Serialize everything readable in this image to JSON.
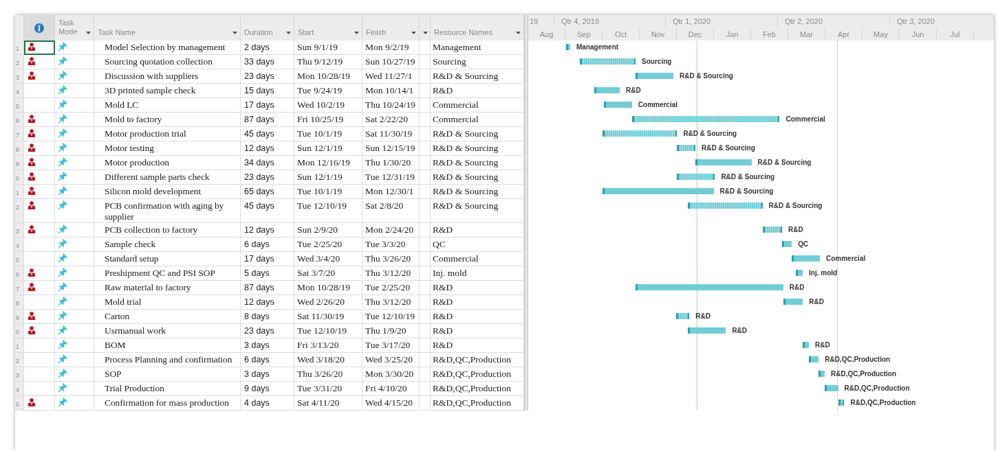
{
  "columns": {
    "task_mode": "Task Mode",
    "task_name": "Task Name",
    "duration": "Duration",
    "start": "Start",
    "finish": "Finish",
    "resource_names": "Resource Names"
  },
  "timescale": {
    "quarters": [
      "19",
      "Qtr 4, 2019",
      "Qtr 1, 2020",
      "Qtr 2, 2020",
      "Qtr 3, 2020"
    ],
    "months": [
      "Aug",
      "Sep",
      "Oct",
      "Nov",
      "Dec",
      "Jan",
      "Feb",
      "Mar",
      "Apr",
      "May",
      "Jun",
      "Jul"
    ]
  },
  "tasks": [
    {
      "id": "1",
      "resource_indicator": true,
      "selected": true,
      "name": "Model Selection by management",
      "duration": "2 days",
      "start": "Sun 9/1/19",
      "finish": "Mon 9/2/19",
      "resources": "Management",
      "bar_label": "Management",
      "hatched": false
    },
    {
      "id": "2",
      "resource_indicator": true,
      "selected": false,
      "name": "Sourcing quotation collection",
      "duration": "33 days",
      "start": "Thu 9/12/19",
      "finish": "Sun 10/27/19",
      "resources": "Sourcing",
      "bar_label": "Sourcing",
      "hatched": true
    },
    {
      "id": "3",
      "resource_indicator": true,
      "selected": false,
      "name": "Discussion with suppliers",
      "duration": "23 days",
      "start": "Mon 10/28/19",
      "finish": "Wed 11/27/1",
      "resources": "R&D & Sourcing",
      "bar_label": "R&D & Sourcing",
      "hatched": false
    },
    {
      "id": "4",
      "resource_indicator": false,
      "selected": false,
      "name": "3D printed sample check",
      "duration": "15 days",
      "start": "Tue 9/24/19",
      "finish": "Mon 10/14/1",
      "resources": "R&D",
      "bar_label": "R&D",
      "hatched": false
    },
    {
      "id": "5",
      "resource_indicator": false,
      "selected": false,
      "name": "Mold LC",
      "duration": "17 days",
      "start": "Wed 10/2/19",
      "finish": "Thu 10/24/19",
      "resources": "Commercial",
      "bar_label": "Commercial",
      "hatched": false
    },
    {
      "id": "6",
      "resource_indicator": true,
      "selected": false,
      "name": "Mold to factory",
      "duration": "87 days",
      "start": "Fri 10/25/19",
      "finish": "Sat 2/22/20",
      "resources": "Commercial",
      "bar_label": "Commercial",
      "hatched": true
    },
    {
      "id": "7",
      "resource_indicator": true,
      "selected": false,
      "name": "Motor production trial",
      "duration": "45 days",
      "start": "Tue 10/1/19",
      "finish": "Sat 11/30/19",
      "resources": "R&D & Sourcing",
      "bar_label": "R&D & Sourcing",
      "hatched": true
    },
    {
      "id": "8",
      "resource_indicator": true,
      "selected": false,
      "name": "Motor testing",
      "duration": "12 days",
      "start": "Sun 12/1/19",
      "finish": "Sun 12/15/19",
      "resources": "R&D & Sourcing",
      "bar_label": "R&D & Sourcing",
      "hatched": true
    },
    {
      "id": "9",
      "resource_indicator": true,
      "selected": false,
      "name": "Motor production",
      "duration": "34 days",
      "start": "Mon 12/16/19",
      "finish": "Thu 1/30/20",
      "resources": "R&D & Sourcing",
      "bar_label": "R&D & Sourcing",
      "hatched": false
    },
    {
      "id": "0",
      "resource_indicator": true,
      "selected": false,
      "name": "Different sample parts check",
      "duration": "23 days",
      "start": "Sun 12/1/19",
      "finish": "Tue 12/31/19",
      "resources": "R&D & Sourcing",
      "bar_label": "R&D & Sourcing",
      "hatched": true
    },
    {
      "id": "1",
      "resource_indicator": true,
      "selected": false,
      "name": "Silicon mold development",
      "duration": "65 days",
      "start": "Tue 10/1/19",
      "finish": "Mon 12/30/1",
      "resources": "R&D & Sourcing",
      "bar_label": "R&D & Sourcing",
      "hatched": false
    },
    {
      "id": "2",
      "resource_indicator": true,
      "selected": false,
      "name": "PCB confirmation with aging by supplier",
      "duration": "45 days",
      "start": "Tue 12/10/19",
      "finish": "Sat 2/8/20",
      "resources": "R&D & Sourcing",
      "bar_label": "R&D & Sourcing",
      "hatched": true
    },
    {
      "id": "3",
      "resource_indicator": true,
      "selected": false,
      "name": "PCB collection to factory",
      "duration": "12 days",
      "start": "Sun 2/9/20",
      "finish": "Mon 2/24/20",
      "resources": "R&D",
      "bar_label": "R&D",
      "hatched": true
    },
    {
      "id": "4",
      "resource_indicator": false,
      "selected": false,
      "name": "Sample check",
      "duration": "6 days",
      "start": "Tue 2/25/20",
      "finish": "Tue 3/3/20",
      "resources": "QC",
      "bar_label": "QC",
      "hatched": false
    },
    {
      "id": "5",
      "resource_indicator": false,
      "selected": false,
      "name": "Standard setup",
      "duration": "17 days",
      "start": "Wed 3/4/20",
      "finish": "Thu 3/26/20",
      "resources": "Commercial",
      "bar_label": "Commercial",
      "hatched": false
    },
    {
      "id": "6",
      "resource_indicator": true,
      "selected": false,
      "name": "Preshipment QC and PSI SOP",
      "duration": "5 days",
      "start": "Sat 3/7/20",
      "finish": "Thu 3/12/20",
      "resources": "Inj. mold",
      "bar_label": "Inj. mold",
      "hatched": false
    },
    {
      "id": "7",
      "resource_indicator": true,
      "selected": false,
      "name": "Raw material to factory",
      "duration": "87 days",
      "start": "Mon 10/28/19",
      "finish": "Tue 2/25/20",
      "resources": "R&D",
      "bar_label": "R&D",
      "hatched": false
    },
    {
      "id": "8",
      "resource_indicator": false,
      "selected": false,
      "name": "Mold trial",
      "duration": "12 days",
      "start": "Wed 2/26/20",
      "finish": "Thu 3/12/20",
      "resources": "R&D",
      "bar_label": "R&D",
      "hatched": false
    },
    {
      "id": "9",
      "resource_indicator": true,
      "selected": false,
      "name": "Carton",
      "duration": "8 days",
      "start": "Sat 11/30/19",
      "finish": "Tue 12/10/19",
      "resources": "R&D",
      "bar_label": "R&D",
      "hatched": true
    },
    {
      "id": "0",
      "resource_indicator": true,
      "selected": false,
      "name": "Usrmanual work",
      "duration": "23 days",
      "start": "Tue 12/10/19",
      "finish": "Thu 1/9/20",
      "resources": "R&D",
      "bar_label": "R&D",
      "hatched": false
    },
    {
      "id": "1",
      "resource_indicator": false,
      "selected": false,
      "name": "BOM",
      "duration": "3 days",
      "start": "Fri 3/13/20",
      "finish": "Tue 3/17/20",
      "resources": "R&D",
      "bar_label": "R&D",
      "hatched": false
    },
    {
      "id": "2",
      "resource_indicator": false,
      "selected": false,
      "name": "Process Planning and confirmation",
      "duration": "6 days",
      "start": "Wed 3/18/20",
      "finish": "Wed 3/25/20",
      "resources": "R&D,QC,Production",
      "bar_label": "R&D,QC,Production",
      "hatched": false
    },
    {
      "id": "3",
      "resource_indicator": false,
      "selected": false,
      "name": "SOP",
      "duration": "3 days",
      "start": "Thu 3/26/20",
      "finish": "Mon 3/30/20",
      "resources": "R&D,QC,Production",
      "bar_label": "R&D,QC,Production",
      "hatched": false
    },
    {
      "id": "4",
      "resource_indicator": false,
      "selected": false,
      "name": "Trial Production",
      "duration": "9 days",
      "start": "Tue 3/31/20",
      "finish": "Fri 4/10/20",
      "resources": "R&D,QC,Production",
      "bar_label": "R&D,QC,Production",
      "hatched": false
    },
    {
      "id": "5",
      "resource_indicator": true,
      "selected": false,
      "name": "Confirmation for mass production",
      "duration": "4 days",
      "start": "Sat 4/11/20",
      "finish": "Wed 4/15/20",
      "resources": "R&D,QC,Production",
      "bar_label": "R&D,QC,Production",
      "hatched": true
    }
  ]
}
